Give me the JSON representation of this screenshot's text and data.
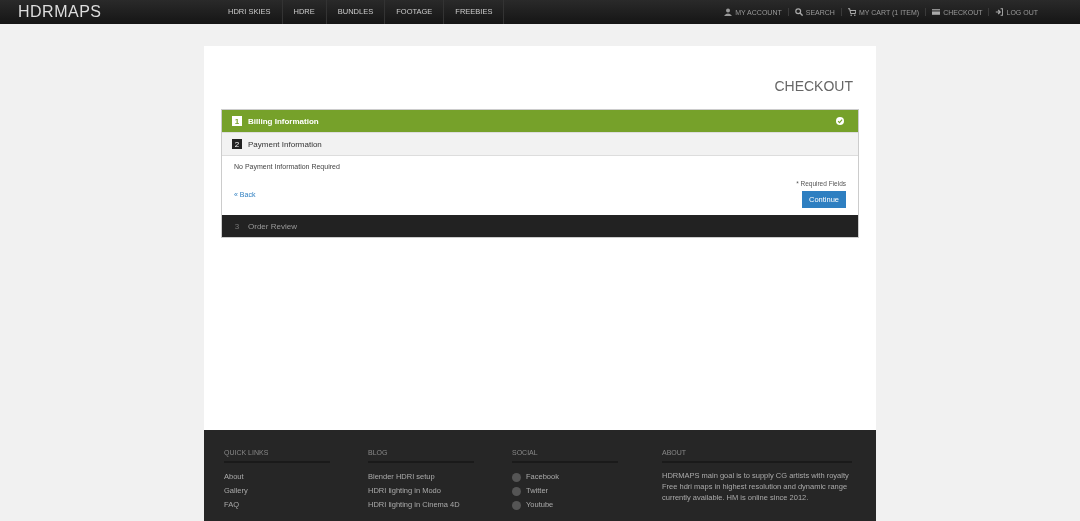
{
  "header": {
    "logo": "HDRMAPS",
    "nav": [
      {
        "label": "HDRI SKIES"
      },
      {
        "label": "HDRE"
      },
      {
        "label": "BUNDLES"
      },
      {
        "label": "FOOTAGE"
      },
      {
        "label": "FREEBIES"
      }
    ],
    "account_links": [
      {
        "label": "MY ACCOUNT",
        "kind": "user"
      },
      {
        "label": "SEARCH",
        "kind": "search"
      },
      {
        "label": "MY CART (1 ITEM)",
        "kind": "cart"
      },
      {
        "label": "CHECKOUT",
        "kind": "card"
      },
      {
        "label": "LOG OUT",
        "kind": "logout"
      }
    ]
  },
  "page_title": "CHECKOUT",
  "steps": [
    {
      "number": "1",
      "title": "Billing Information",
      "completed": true,
      "expanded": false
    },
    {
      "number": "2",
      "title": "Payment Information",
      "completed": false,
      "expanded": true,
      "message": "No Payment Information Required",
      "required_note": "* Required Fields",
      "back_link": "« Back",
      "continue_button": "Continue"
    },
    {
      "number": "3",
      "title": "Order Review",
      "completed": false,
      "expanded": false
    }
  ],
  "footer": {
    "columns": [
      {
        "heading": "QUICK LINKS",
        "kind": "links",
        "items": [
          {
            "label": "About"
          },
          {
            "label": "Gallery"
          },
          {
            "label": "FAQ"
          }
        ]
      },
      {
        "heading": "BLOG",
        "kind": "links",
        "items": [
          {
            "label": "Blender HDRI setup"
          },
          {
            "label": "HDRI lighting in Modo"
          },
          {
            "label": "HDRI lighting in Cinema 4D"
          }
        ]
      },
      {
        "heading": "SOCIAL",
        "kind": "social",
        "items": [
          {
            "label": "Facebook"
          },
          {
            "label": "Twitter"
          },
          {
            "label": "Youtube"
          }
        ]
      },
      {
        "heading": "ABOUT",
        "kind": "text",
        "text": "HDRMAPS main goal is to supply CG artists with royalty Free hdri maps in highest resolution and dynamic range currently available. HM is online since 2012."
      }
    ]
  }
}
